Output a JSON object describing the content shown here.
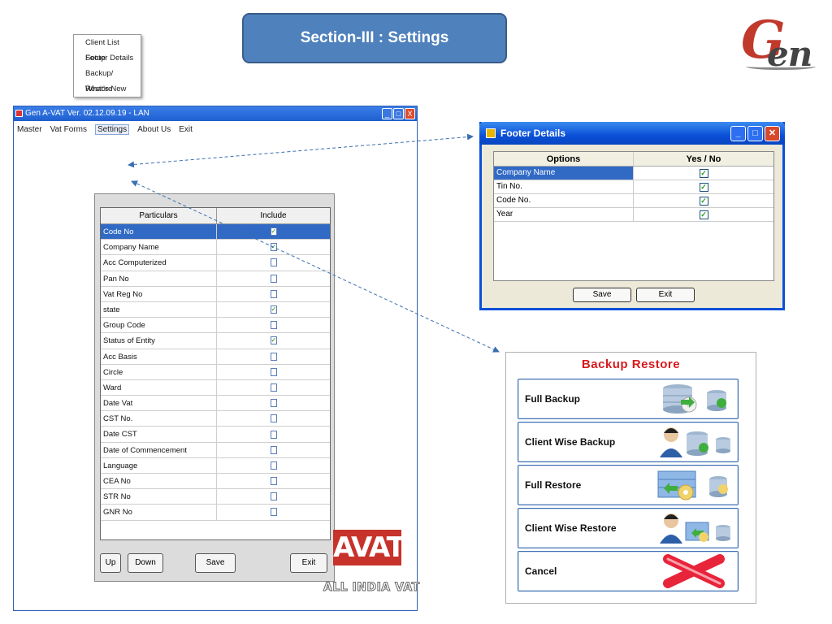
{
  "banner": {
    "title": "Section-III : Settings"
  },
  "logo": {
    "text_g": "G",
    "text_en": "en"
  },
  "main_window": {
    "title": "Gen A-VAT Ver. 02.12.09.19 - LAN",
    "menu": [
      "Master",
      "Vat Forms",
      "Settings",
      "About Us",
      "Exit"
    ],
    "settings_menu": [
      "Client List Setup",
      "Footer Details",
      "Backup/ Restore",
      "What's New"
    ],
    "list": {
      "headers": [
        "Particulars",
        "Include"
      ],
      "rows": [
        {
          "label": "Code No",
          "checked": true
        },
        {
          "label": "Company Name",
          "checked": true
        },
        {
          "label": "Acc Computerized",
          "checked": false
        },
        {
          "label": "Pan No",
          "checked": false
        },
        {
          "label": "Vat Reg No",
          "checked": false
        },
        {
          "label": "state",
          "checked": true
        },
        {
          "label": "Group Code",
          "checked": false
        },
        {
          "label": "Status of Entity",
          "checked": true
        },
        {
          "label": "Acc Basis",
          "checked": false
        },
        {
          "label": "Circle",
          "checked": false
        },
        {
          "label": "Ward",
          "checked": false
        },
        {
          "label": "Date Vat",
          "checked": false
        },
        {
          "label": "CST No.",
          "checked": false
        },
        {
          "label": "Date CST",
          "checked": false
        },
        {
          "label": "Date of Commencement",
          "checked": false
        },
        {
          "label": "Language",
          "checked": false
        },
        {
          "label": "CEA No",
          "checked": false
        },
        {
          "label": "STR No",
          "checked": false
        },
        {
          "label": "GNR No",
          "checked": false
        }
      ],
      "buttons": {
        "up": "Up",
        "down": "Down",
        "save": "Save",
        "exit": "Exit"
      }
    },
    "avat_logo": "AVAT",
    "avat_sub": "ALL INDIA VAT"
  },
  "footer_details": {
    "title": "Footer Details",
    "headers": [
      "Options",
      "Yes / No"
    ],
    "rows": [
      {
        "label": "Company Name",
        "checked": true
      },
      {
        "label": "Tin No.",
        "checked": true
      },
      {
        "label": "Code No.",
        "checked": true
      },
      {
        "label": "Year",
        "checked": true
      }
    ],
    "save": "Save",
    "exit": "Exit"
  },
  "backup_restore": {
    "title": "Backup Restore",
    "buttons": [
      "Full Backup",
      "Client Wise Backup",
      "Full Restore",
      "Client Wise Restore",
      "Cancel"
    ]
  },
  "colors": {
    "accent": "#4f81bd",
    "xp_blue": "#0a50d8",
    "selected_row": "#316ac5",
    "backup_title": "#d8191c",
    "avat_red": "#c7322b"
  }
}
